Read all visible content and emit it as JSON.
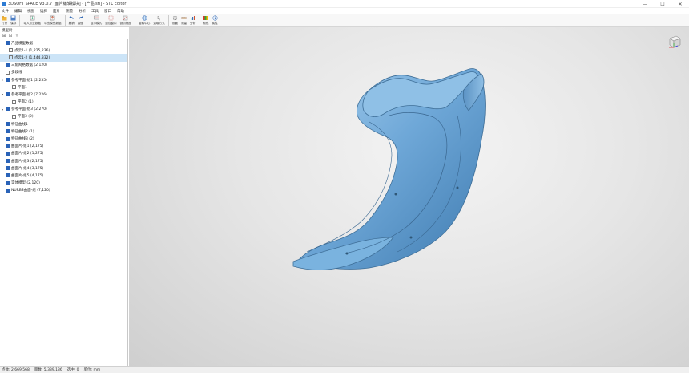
{
  "app": {
    "title": "3DSOFT SPACE V3.0.7 [面片编辑模块] - [产品.stl] - STL Editor"
  },
  "window_controls": [
    "—",
    "☐",
    "✕"
  ],
  "menu": [
    "文件",
    "编辑",
    "视图",
    "选择",
    "面片",
    "测量",
    "分析",
    "工具",
    "窗口",
    "帮助"
  ],
  "toolbar": [
    {
      "icon": "folder-icon",
      "label": "打开"
    },
    {
      "icon": "save-icon",
      "label": "保存"
    },
    {
      "sep": true
    },
    {
      "icon": "import-icon",
      "label": "导入点云数据"
    },
    {
      "icon": "export-icon",
      "label": "导出模型数据"
    },
    {
      "sep": true
    },
    {
      "icon": "undo-icon",
      "label": "撤销"
    },
    {
      "icon": "redo-icon",
      "label": "重做"
    },
    {
      "sep": true
    },
    {
      "icon": "display-icon",
      "label": "显示模式"
    },
    {
      "icon": "fit-icon",
      "label": "适合窗口"
    },
    {
      "icon": "section-icon",
      "label": "剖切视图"
    },
    {
      "sep": true
    },
    {
      "icon": "globe-icon",
      "label": "旋转中心"
    },
    {
      "icon": "pick-icon",
      "label": "选取方式"
    },
    {
      "sep": true
    },
    {
      "icon": "settings-icon",
      "label": "设置"
    },
    {
      "icon": "measure-icon",
      "label": "测量"
    },
    {
      "icon": "analysis-icon",
      "label": "分析"
    },
    {
      "sep": true
    },
    {
      "icon": "color-icon",
      "label": "颜色"
    },
    {
      "icon": "info-icon",
      "label": "属性"
    }
  ],
  "panel": {
    "title": "模型树"
  },
  "tree": [
    {
      "label": "产品模型数据",
      "checked": true,
      "expander": "",
      "indent": 0,
      "selected": false
    },
    {
      "label": "点云1-1 (1,225,236)",
      "checked": false,
      "expander": "",
      "indent": 1,
      "selected": false
    },
    {
      "label": "点云1-2 (1,444,332)",
      "checked": false,
      "expander": "",
      "indent": 1,
      "selected": true
    },
    {
      "label": "三角网格数据 (2,120)",
      "checked": true,
      "expander": "",
      "indent": 0,
      "selected": false
    },
    {
      "label": "多段线",
      "checked": false,
      "expander": "",
      "indent": 0,
      "selected": false
    },
    {
      "label": "参考平面-组1 (2,235)",
      "checked": true,
      "expander": "▸",
      "indent": 0,
      "selected": false
    },
    {
      "label": "平面1",
      "checked": false,
      "expander": "",
      "indent": 2,
      "selected": false
    },
    {
      "label": "参考平面-组2 (7,226)",
      "checked": true,
      "expander": "▾",
      "indent": 0,
      "selected": false
    },
    {
      "label": "平面2 (1)",
      "checked": false,
      "expander": "",
      "indent": 2,
      "selected": false
    },
    {
      "label": "参考平面-组3 (2,270)",
      "checked": true,
      "expander": "▾",
      "indent": 0,
      "selected": false
    },
    {
      "label": "平面3 (2)",
      "checked": false,
      "expander": "",
      "indent": 2,
      "selected": false
    },
    {
      "label": "特征曲线1",
      "checked": true,
      "expander": "",
      "indent": 0,
      "selected": false
    },
    {
      "label": "特征曲线2 (1)",
      "checked": true,
      "expander": "",
      "indent": 0,
      "selected": false
    },
    {
      "label": "特征曲线3 (2)",
      "checked": true,
      "expander": "",
      "indent": 0,
      "selected": false
    },
    {
      "label": "曲面片-组1 (2,175)",
      "checked": true,
      "expander": "",
      "indent": 0,
      "selected": false
    },
    {
      "label": "曲面片-组2 (1,275)",
      "checked": true,
      "expander": "",
      "indent": 0,
      "selected": false
    },
    {
      "label": "曲面片-组3 (2,175)",
      "checked": true,
      "expander": "",
      "indent": 0,
      "selected": false
    },
    {
      "label": "曲面片-组4 (3,175)",
      "checked": true,
      "expander": "",
      "indent": 0,
      "selected": false
    },
    {
      "label": "曲面片-组5 (4,175)",
      "checked": true,
      "expander": "",
      "indent": 0,
      "selected": false
    },
    {
      "label": "实体模型 (2,120)",
      "checked": true,
      "expander": "",
      "indent": 0,
      "selected": false
    },
    {
      "label": "NURBS曲面-组 (7,120)",
      "checked": true,
      "expander": "",
      "indent": 0,
      "selected": false
    }
  ],
  "status": [
    "点数: 2,669,568",
    "面数: 5,339,136",
    "选中: 0",
    "单位: mm"
  ],
  "colors": {
    "model": "#6fa8d8",
    "model_edge": "#3f6f98",
    "selection": "#cce4f7",
    "check": "#2a63b8"
  }
}
